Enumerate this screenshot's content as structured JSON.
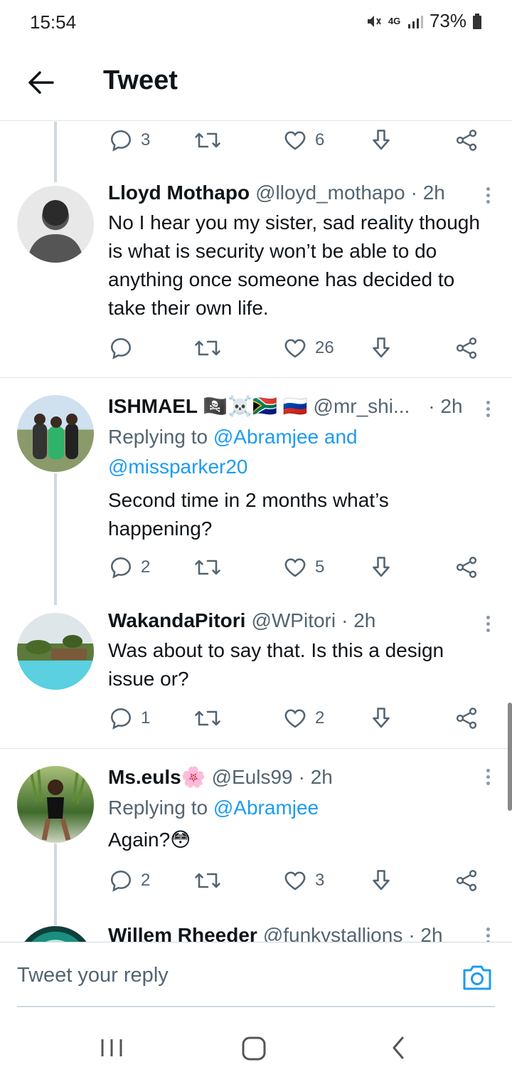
{
  "status": {
    "time": "15:54",
    "network": "4G",
    "battery": "73%"
  },
  "header": {
    "title": "Tweet"
  },
  "top_actions": {
    "replies": "3",
    "likes": "6"
  },
  "tweets": [
    {
      "name": "Lloyd Mothapo",
      "handle": "@lloyd_mothapo",
      "time": "· 2h",
      "text": "No I hear you my sister, sad reality though is what is security won’t be able to do anything once someone has decided to take their own life.",
      "replies": "",
      "likes": "26"
    },
    {
      "name": "ISHMAEL 🏴‍☠️☠️🇿🇦 🇷🇺",
      "handle": "@mr_shi...",
      "time": "· 2h",
      "replying_prefix": "Replying to ",
      "replying_to": "@Abramjee and @missparker20",
      "text": "Second time in 2 months what’s happening?",
      "replies": "2",
      "likes": "5"
    },
    {
      "name": "WakandaPitori",
      "handle": "@WPitori",
      "time": "· 2h",
      "text": "Was about to say that. Is this a design issue or?",
      "replies": "1",
      "likes": "2"
    },
    {
      "name": "Ms.euls🌸",
      "handle": "@Euls99",
      "time": "· 2h",
      "replying_prefix": "Replying to ",
      "replying_to": "@Abramjee",
      "text": "Again?😳",
      "replies": "2",
      "likes": "3"
    },
    {
      "name": "Willem Rheeder",
      "handle": "@funkystallions",
      "time": "· 2h"
    }
  ],
  "reply_bar": {
    "placeholder": "Tweet your reply"
  },
  "colors": {
    "accent": "#1d9bf0",
    "text": "#0f1419",
    "muted": "#536471",
    "divider": "#e1e6ea"
  },
  "icons": [
    "back-arrow-icon",
    "reply-icon",
    "retweet-icon",
    "like-icon",
    "download-icon",
    "share-icon",
    "more-icon",
    "camera-icon",
    "recents-icon",
    "home-icon",
    "nav-back-icon"
  ]
}
